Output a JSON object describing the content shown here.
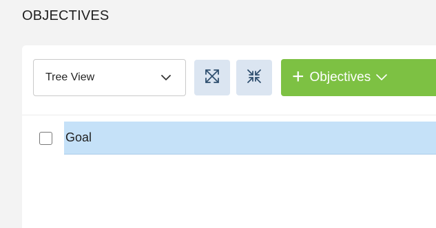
{
  "page": {
    "title": "OBJECTIVES"
  },
  "toolbar": {
    "view_select": {
      "selected": "Tree View",
      "icon": "chevron-down-icon"
    },
    "expand_button_icon": "expand-all-icon",
    "collapse_button_icon": "collapse-all-icon",
    "add_button": {
      "plus": "+",
      "label": "Objectives",
      "icon": "chevron-down-icon"
    }
  },
  "tree": {
    "rows": [
      {
        "label": "Goal",
        "checked": false,
        "selected": true
      }
    ]
  },
  "colors": {
    "page_bg": "#f3f3f3",
    "panel_bg": "#ffffff",
    "icon_button_bg": "#dbe5f1",
    "icon_color": "#2f4f6f",
    "add_button_bg": "#7dc143",
    "row_highlight": "#c5e1f8"
  }
}
